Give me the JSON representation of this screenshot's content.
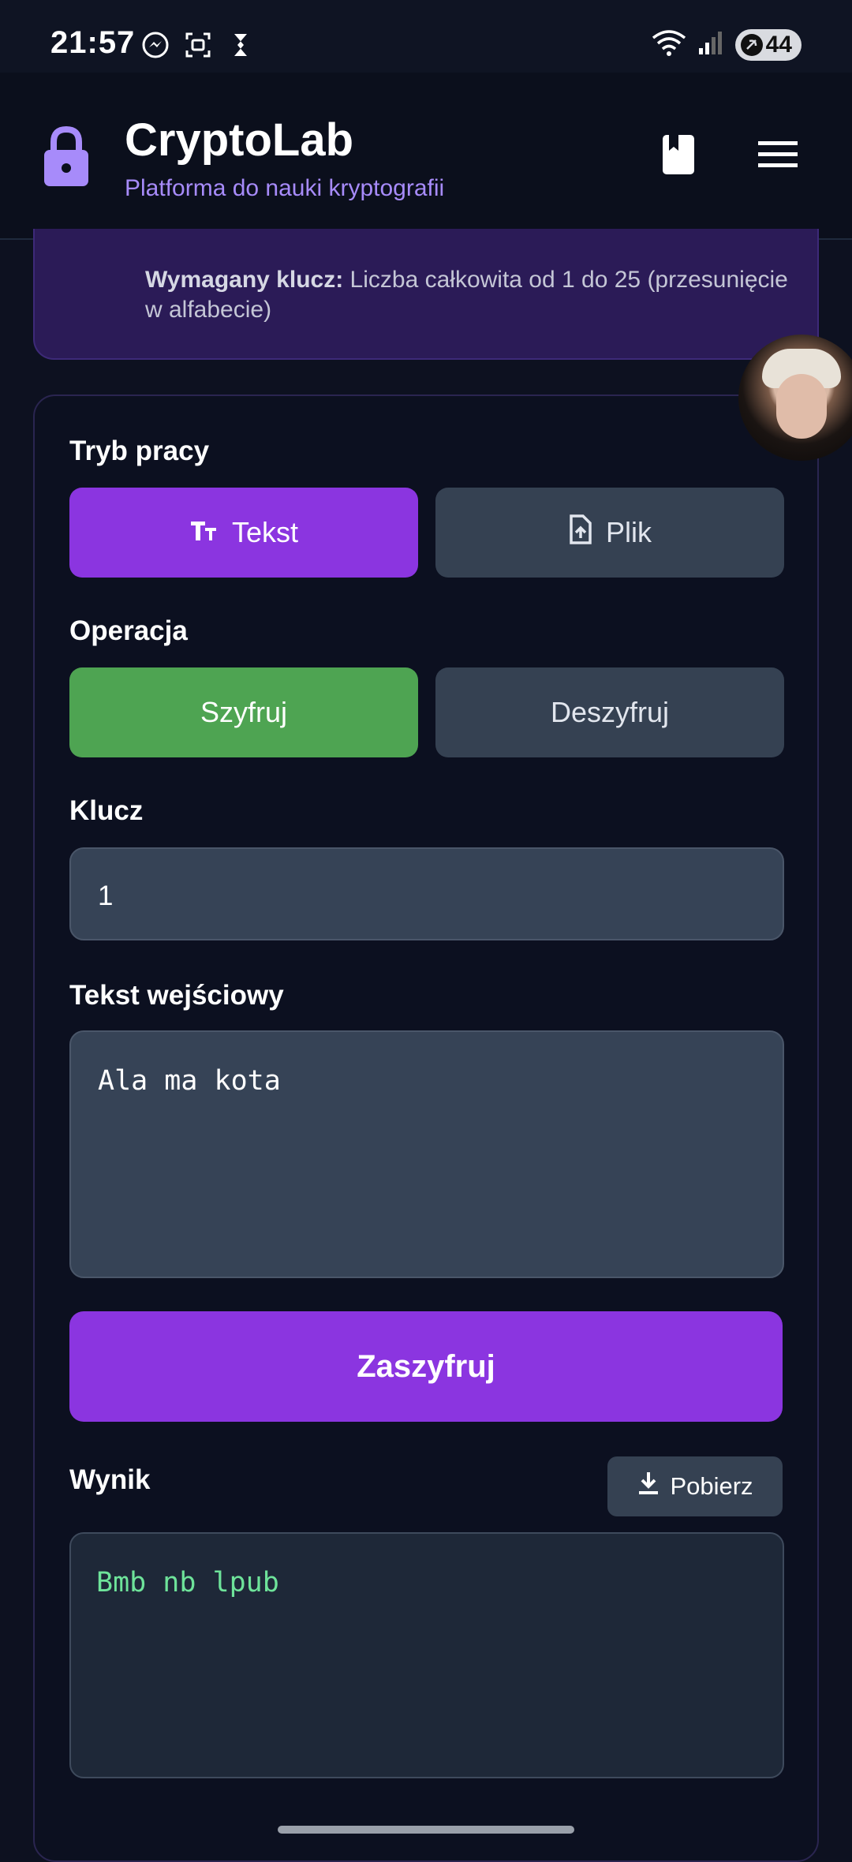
{
  "status_bar": {
    "time": "21:57",
    "battery": "44",
    "icons": [
      "messenger-icon",
      "screenshot-icon",
      "app-icon",
      "wifi-icon",
      "signal-icon",
      "battery-icon"
    ]
  },
  "header": {
    "title": "CryptoLab",
    "subtitle": "Platforma do nauki kryptografii",
    "icons": [
      "lock-icon",
      "book-icon",
      "menu-icon"
    ],
    "accent_color": "#a78bfa"
  },
  "info": {
    "key_label": "Wymagany klucz:",
    "key_text": " Liczba całkowita od 1 do 25 (przesunięcie w alfabecie)"
  },
  "mode": {
    "label": "Tryb pracy",
    "options": [
      {
        "label": "Tekst",
        "icon": "text-format-icon",
        "selected": true
      },
      {
        "label": "Plik",
        "icon": "file-upload-icon",
        "selected": false
      }
    ]
  },
  "operation": {
    "label": "Operacja",
    "options": [
      {
        "label": "Szyfruj",
        "selected": true
      },
      {
        "label": "Deszyfruj",
        "selected": false
      }
    ]
  },
  "key": {
    "label": "Klucz",
    "value": "1"
  },
  "input_text": {
    "label": "Tekst wejściowy",
    "value": "Ala ma kota"
  },
  "submit_label": "Zaszyfruj",
  "result": {
    "label": "Wynik",
    "download_label": "Pobierz",
    "value": "Bmb nb lpub"
  },
  "colors": {
    "primary_purple": "#8b35e0",
    "success_green": "#4ea452",
    "output_text": "#6ee39a",
    "background": "#0d1120"
  }
}
